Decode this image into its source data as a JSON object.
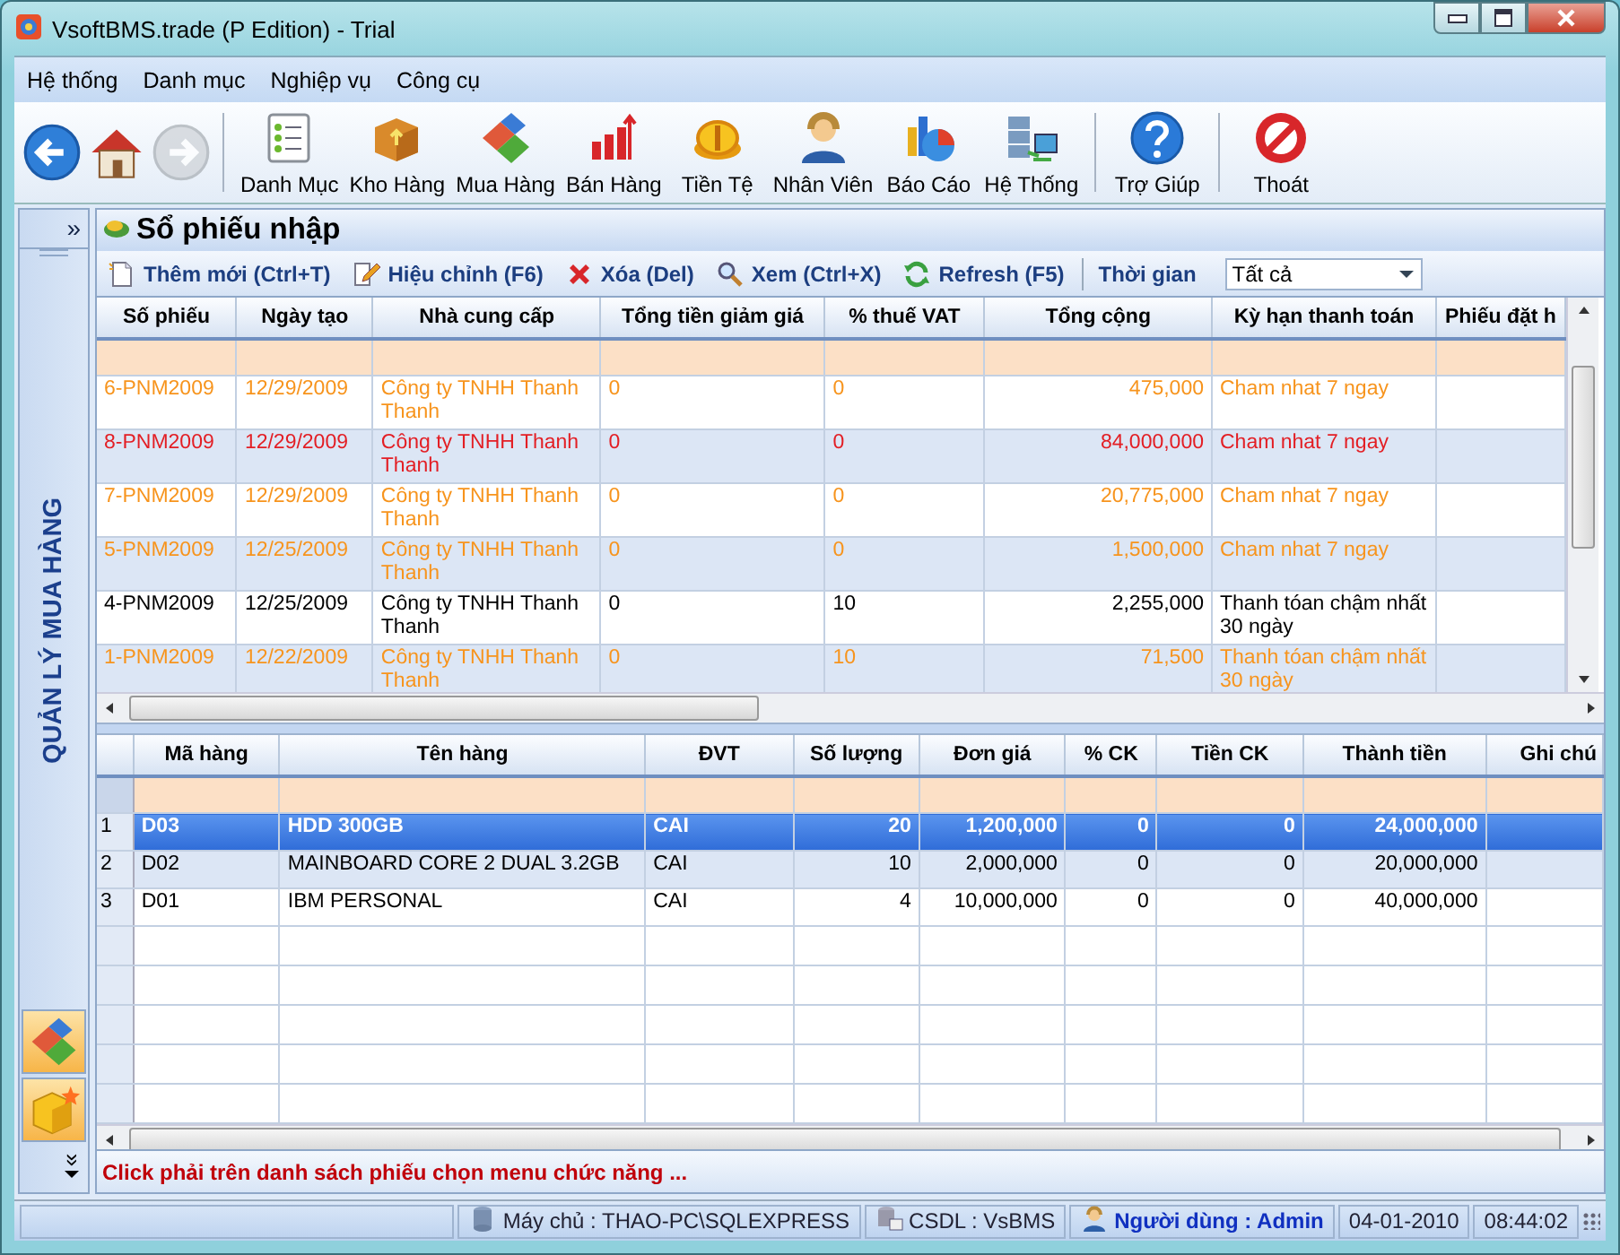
{
  "window": {
    "title": "VsoftBMS.trade (P Edition) - Trial"
  },
  "menu": [
    "Hệ thống",
    "Danh mục",
    "Nghiệp vụ",
    "Công cụ"
  ],
  "nav_buttons": [
    {
      "kind": "back",
      "disabled": false
    },
    {
      "kind": "home",
      "disabled": false
    },
    {
      "kind": "forward",
      "disabled": true
    }
  ],
  "toolbar": {
    "groups": [
      [
        "Danh Mục",
        "Kho Hàng",
        "Mua Hàng",
        "Bán Hàng",
        "Tiền Tệ",
        "Nhân Viên",
        "Báo Cáo",
        "Hệ Thống"
      ],
      [
        "Trợ Giúp"
      ],
      [
        "Thoát"
      ]
    ]
  },
  "sidebar": {
    "expand": "»",
    "title": "QUẢN LÝ MUA HÀNG",
    "footer_toggle": "»"
  },
  "panel": {
    "title": "Sổ phiếu nhập",
    "actions": [
      {
        "kind": "add",
        "label": "Thêm mới (Ctrl+T)"
      },
      {
        "kind": "edit",
        "label": "Hiệu chỉnh (F6)"
      },
      {
        "kind": "delete",
        "label": "Xóa (Del)"
      },
      {
        "kind": "view",
        "label": "Xem (Ctrl+X)"
      },
      {
        "kind": "refresh",
        "label": "Refresh (F5)"
      }
    ],
    "period": {
      "label": "Thời gian",
      "value": "Tất cả"
    }
  },
  "purchase_list": {
    "columns": [
      "Số phiếu",
      "Ngày tạo",
      "Nhà cung cấp",
      "Tổng tiền giảm giá",
      "% thuế VAT",
      "Tổng cộng",
      "Kỳ hạn thanh toán",
      "Phiếu đặt h"
    ],
    "rows": [
      {
        "cells": [
          "6-PNM2009",
          "12/29/2009",
          "Công ty TNHH Thanh Thanh",
          "0",
          "0",
          "475,000",
          "Cham nhat 7 ngay"
        ],
        "color": "#f7941d"
      },
      {
        "cells": [
          "8-PNM2009",
          "12/29/2009",
          "Công ty TNHH Thanh Thanh",
          "0",
          "0",
          "84,000,000",
          "Cham nhat 7 ngay"
        ],
        "color": "#e31e24"
      },
      {
        "cells": [
          "7-PNM2009",
          "12/29/2009",
          "Công ty TNHH Thanh Thanh",
          "0",
          "0",
          "20,775,000",
          "Cham nhat 7 ngay"
        ],
        "color": "#f7941d"
      },
      {
        "cells": [
          "5-PNM2009",
          "12/25/2009",
          "Công ty TNHH Thanh Thanh",
          "0",
          "0",
          "1,500,000",
          "Cham nhat 7 ngay"
        ],
        "color": "#f7941d"
      },
      {
        "cells": [
          "4-PNM2009",
          "12/25/2009",
          "Công ty TNHH Thanh Thanh",
          "0",
          "10",
          "2,255,000",
          "Thanh tóan chậm nhất 30 ngày"
        ],
        "color": "#000000"
      },
      {
        "cells": [
          "1-PNM2009",
          "12/22/2009",
          "Công ty TNHH Thanh Thanh",
          "0",
          "10",
          "71,500",
          "Thanh tóan chậm nhất 30 ngày"
        ],
        "color": "#f7941d"
      }
    ]
  },
  "item_list": {
    "columns": [
      "Mã hàng",
      "Tên hàng",
      "ĐVT",
      "Số lượng",
      "Đơn giá",
      "% CK",
      "Tiền CK",
      "Thành tiền",
      "Ghi chú"
    ],
    "rows": [
      {
        "no": "1",
        "cells": [
          "D03",
          "HDD 300GB",
          "CAI",
          "20",
          "1,200,000",
          "0",
          "0",
          "24,000,000"
        ],
        "selected": true
      },
      {
        "no": "2",
        "cells": [
          "D02",
          "MAINBOARD CORE 2 DUAL 3.2GB",
          "CAI",
          "10",
          "2,000,000",
          "0",
          "0",
          "20,000,000"
        ],
        "selected": false
      },
      {
        "no": "3",
        "cells": [
          "D01",
          "IBM PERSONAL",
          "CAI",
          "4",
          "10,000,000",
          "0",
          "0",
          "40,000,000"
        ],
        "selected": false
      }
    ]
  },
  "hint": "Click phải trên danh sách phiếu chọn menu chức năng ...",
  "status_bar": {
    "server": "Máy chủ : THAO-PC\\SQLEXPRESS",
    "database": "CSDL : VsBMS",
    "user": "Người dùng : Admin",
    "date": "04-01-2010",
    "time": "08:44:02"
  }
}
